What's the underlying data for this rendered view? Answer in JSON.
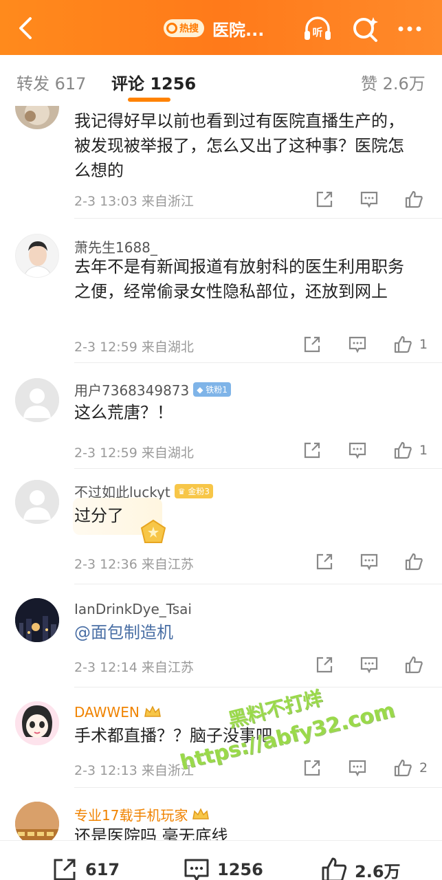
{
  "header": {
    "back_icon": "chevron-left-icon",
    "hot_badge": "热搜",
    "title": "医院...",
    "listen_label": "听"
  },
  "tabs": {
    "repost_label": "转发",
    "repost_count": "617",
    "comment_label": "评论",
    "comment_count": "1256",
    "like_label": "赞",
    "like_count": "2.6万"
  },
  "comments": [
    {
      "user": "",
      "text": "我记得好早以前也看到过有医院直播生产的，被发现被举报了，怎么又出了这种事？医院怎么想的",
      "meta": "2-3 13:03  来自浙江",
      "likes": ""
    },
    {
      "user": "萧先生1688_",
      "text": "去年不是有新闻报道有放射科的医生利用职务之便，经常偷录女性隐私部位，还放到网上",
      "meta": "2-3 12:59  来自湖北",
      "likes": "1"
    },
    {
      "user": "用户7368349873",
      "badge": "铁粉1",
      "text": "这么荒唐？！",
      "meta": "2-3 12:59  来自湖北",
      "likes": "1"
    },
    {
      "user": "不过如此luckyt",
      "badge": "金粉3",
      "text": "过分了",
      "meta": "2-3 12:36  来自江苏",
      "likes": ""
    },
    {
      "user": "IanDrinkDye_Tsai",
      "text": "@面包制造机",
      "meta": "2-3 12:14  来自江苏",
      "likes": ""
    },
    {
      "user": "DAWWEN",
      "text": "手术都直播？？脑子没事吧",
      "meta": "2-3 12:13  来自浙江",
      "likes": "2"
    },
    {
      "user": "专业17载手机玩家",
      "text": "还是医院吗 毫无底线",
      "meta": "",
      "likes": ""
    }
  ],
  "watermark": {
    "line1": "黑料不打烊",
    "line2": "https://abfy32.com"
  },
  "bottom_bar": {
    "repost_count": "617",
    "comment_count": "1256",
    "like_count": "2.6万"
  },
  "colors": {
    "header_orange": "#ff7a1a",
    "accent": "#ff8200",
    "link_blue": "#4a6fa5",
    "vip_name": "#f08300"
  }
}
